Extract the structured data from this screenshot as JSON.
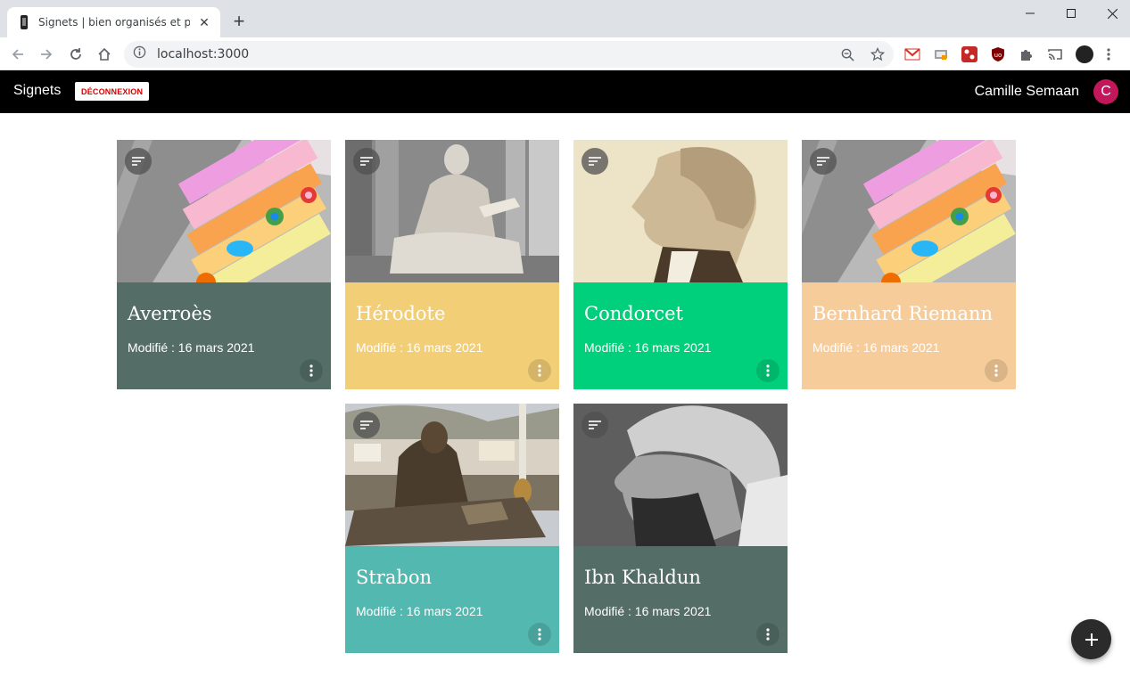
{
  "browser": {
    "tab_title": "Signets | bien organisés et partagés",
    "url": "localhost:3000"
  },
  "app": {
    "brand": "Signets",
    "logout_label": "DÉCONNEXION",
    "user_name": "Camille Semaan",
    "avatar_letter": "C",
    "avatar_color": "#c2185b"
  },
  "cards": [
    {
      "name": "Averroès",
      "modified": "Modifié : 16 mars 2021",
      "color": "#546e67",
      "image": "bookmark-tabs-image"
    },
    {
      "name": "Hérodote",
      "modified": "Modifié : 16 mars 2021",
      "color": "#f2cf77",
      "image": "statue-image"
    },
    {
      "name": "Condorcet",
      "modified": "Modifié : 16 mars 2021",
      "color": "#00d07c",
      "image": "portrait-image"
    },
    {
      "name": "Bernhard Riemann",
      "modified": "Modifié : 16 mars 2021",
      "color": "#f6cd9a",
      "image": "bookmark-tabs-image"
    },
    {
      "name": "Strabon",
      "modified": "Modifié : 16 mars 2021",
      "color": "#53b8b0",
      "image": "monument-image"
    },
    {
      "name": "Ibn Khaldun",
      "modified": "Modifié : 16 mars 2021",
      "color": "#546e67",
      "image": "portrait-image"
    }
  ]
}
